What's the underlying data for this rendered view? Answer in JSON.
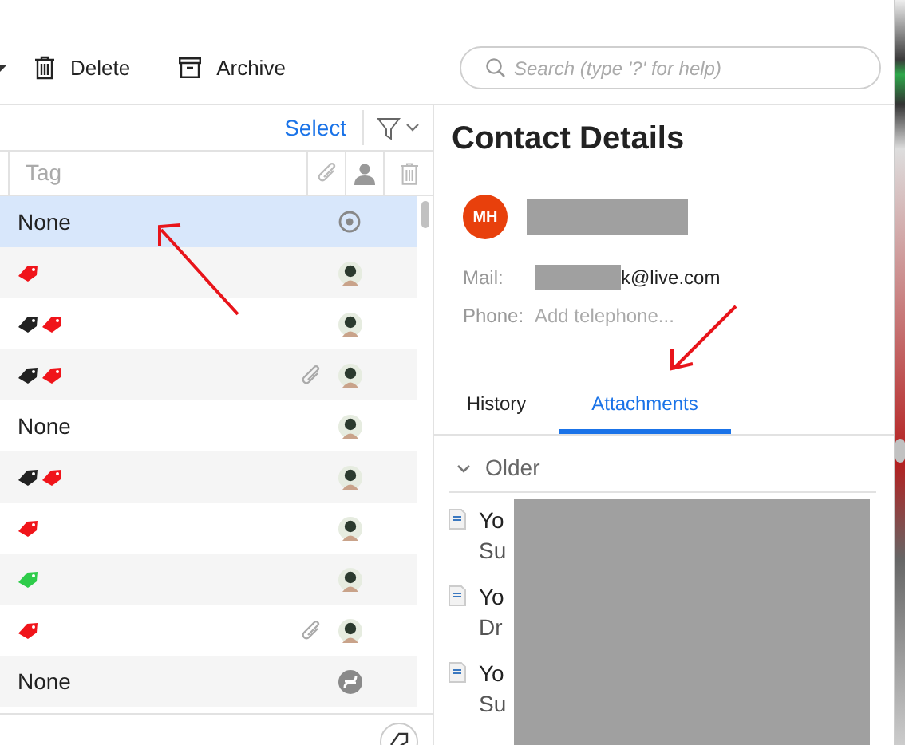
{
  "toolbar": {
    "buttons": [
      {
        "kind": "delete",
        "label": "Delete"
      },
      {
        "kind": "archive",
        "label": "Archive"
      }
    ]
  },
  "search": {
    "placeholder": "Search (type '?' for help)"
  },
  "list": {
    "select_label": "Select",
    "columns": [
      {
        "kind": "text",
        "label": "Tag"
      },
      {
        "kind": "attachment"
      },
      {
        "kind": "person"
      },
      {
        "kind": "trash"
      }
    ],
    "rows": [
      {
        "tag_text": "None",
        "tags": [],
        "attachment": false,
        "sender": {
          "kind": "target"
        },
        "selected": true
      },
      {
        "tags": [
          {
            "color": "#f0141a"
          }
        ],
        "attachment": false,
        "sender": {
          "kind": "avatar"
        },
        "selected": false
      },
      {
        "tags": [
          {
            "color": "#222222"
          },
          {
            "color": "#f0141a"
          }
        ],
        "attachment": false,
        "sender": {
          "kind": "avatar"
        },
        "selected": false
      },
      {
        "tags": [
          {
            "color": "#222222"
          },
          {
            "color": "#f0141a"
          }
        ],
        "attachment": true,
        "sender": {
          "kind": "avatar"
        },
        "selected": false
      },
      {
        "tag_text": "None",
        "tags": [],
        "attachment": false,
        "sender": {
          "kind": "avatar"
        },
        "selected": false
      },
      {
        "tags": [
          {
            "color": "#222222"
          },
          {
            "color": "#f0141a"
          }
        ],
        "attachment": false,
        "sender": {
          "kind": "avatar"
        },
        "selected": false
      },
      {
        "tags": [
          {
            "color": "#f0141a"
          }
        ],
        "attachment": false,
        "sender": {
          "kind": "avatar"
        },
        "selected": false
      },
      {
        "tags": [
          {
            "color": "#2ecc4a"
          }
        ],
        "attachment": false,
        "sender": {
          "kind": "avatar"
        },
        "selected": false
      },
      {
        "tags": [
          {
            "color": "#f0141a"
          }
        ],
        "attachment": true,
        "sender": {
          "kind": "avatar"
        },
        "selected": false
      },
      {
        "tag_text": "None",
        "tags": [],
        "attachment": false,
        "sender": {
          "kind": "swirl"
        },
        "selected": false
      }
    ]
  },
  "contact": {
    "title": "Contact Details",
    "initials": "MH",
    "fields": [
      {
        "kind": "value",
        "label": "Mail:",
        "value": "k@live.com"
      },
      {
        "kind": "input",
        "label": "Phone:",
        "placeholder": "Add telephone..."
      }
    ]
  },
  "tabs": [
    {
      "label": "History",
      "selected": false
    },
    {
      "label": "Attachments",
      "selected": true
    }
  ],
  "attachments": {
    "group": "Older",
    "items": [
      {
        "title": "Yo",
        "subtitle": "Su"
      },
      {
        "title": "Yo",
        "subtitle": "Dr"
      },
      {
        "title": "Yo",
        "subtitle": "Su"
      }
    ]
  }
}
